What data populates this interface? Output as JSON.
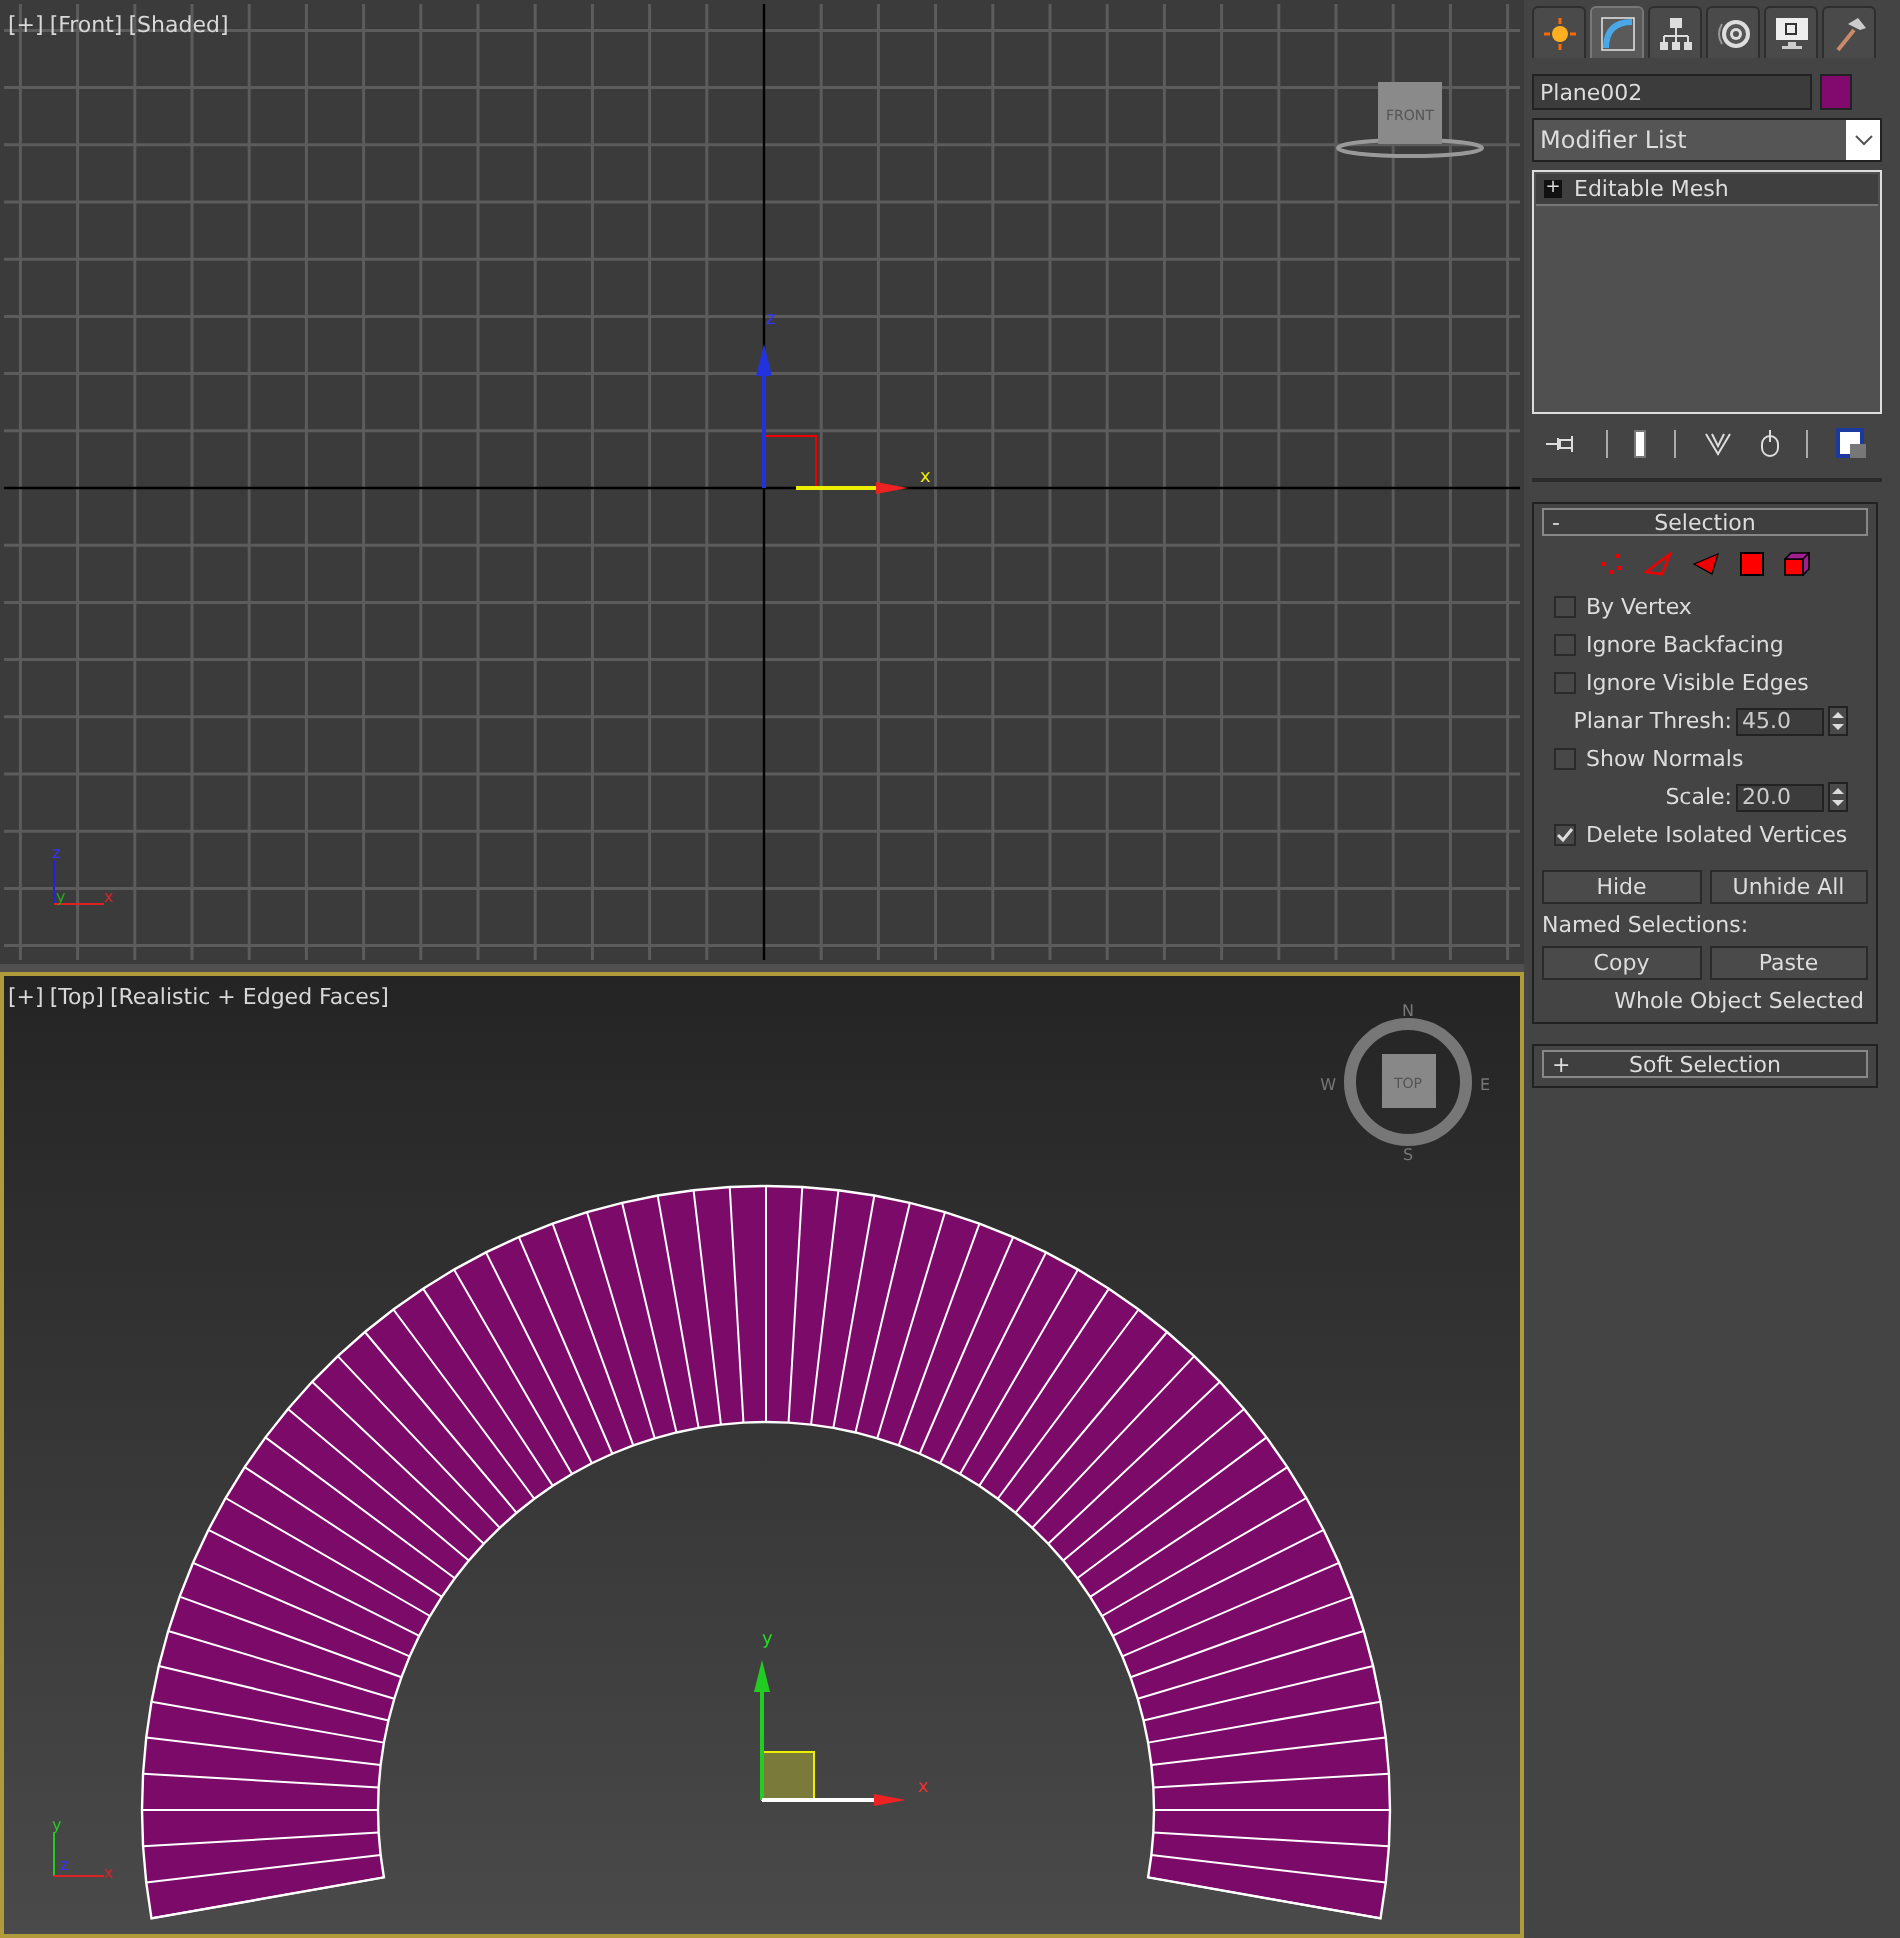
{
  "viewports": [
    {
      "kind": "front",
      "active": false,
      "label_parts": [
        "[+]",
        "[Front]",
        "[Shaded]"
      ],
      "viewcube_label": "FRONT",
      "gizmo_axes": [
        "z",
        "x"
      ],
      "tripod_axes": [
        "z",
        "y",
        "x"
      ]
    },
    {
      "kind": "top",
      "active": true,
      "label_parts": [
        "[+]",
        "[Top]",
        "[Realistic + Edged Faces]"
      ],
      "viewcube_label": "TOP",
      "compass": [
        "N",
        "W",
        "E",
        "S"
      ],
      "gizmo_axes": [
        "y",
        "x"
      ],
      "tripod_axes": [
        "y",
        "z",
        "x"
      ]
    }
  ],
  "command_panel": {
    "tabs": [
      {
        "kind": "create",
        "selected": false
      },
      {
        "kind": "modify",
        "selected": true
      },
      {
        "kind": "hierarchy",
        "selected": false
      },
      {
        "kind": "motion",
        "selected": false
      },
      {
        "kind": "display",
        "selected": false
      },
      {
        "kind": "utilities",
        "selected": false
      }
    ],
    "object": {
      "name": "Plane002",
      "color": "#820a6e"
    },
    "modifier_list": "Modifier List",
    "stack": [
      {
        "toggle": "+",
        "label": "Editable Mesh",
        "selected": true
      }
    ],
    "rollouts": [
      {
        "toggle": "-",
        "title": "Selection",
        "expanded": true,
        "items": [
          {
            "kind": "checkbox",
            "label": "By Vertex",
            "checked": false
          },
          {
            "kind": "checkbox",
            "label": "Ignore Backfacing",
            "checked": false
          },
          {
            "kind": "checkbox",
            "label": "Ignore Visible Edges",
            "checked": false
          },
          {
            "kind": "spinner",
            "label": "Planar Thresh:",
            "value": "45.0"
          },
          {
            "kind": "checkbox",
            "label": "Show Normals",
            "checked": false
          },
          {
            "kind": "spinner",
            "label": "Scale:",
            "value": "20.0"
          },
          {
            "kind": "checkbox",
            "label": "Delete Isolated Vertices",
            "checked": true
          }
        ],
        "buttons": [
          "Hide",
          "Unhide All"
        ],
        "named_selections_label": "Named Selections:",
        "named_buttons": [
          "Copy",
          "Paste"
        ],
        "status": "Whole Object Selected"
      },
      {
        "toggle": "+",
        "title": "Soft Selection",
        "expanded": false
      }
    ]
  }
}
